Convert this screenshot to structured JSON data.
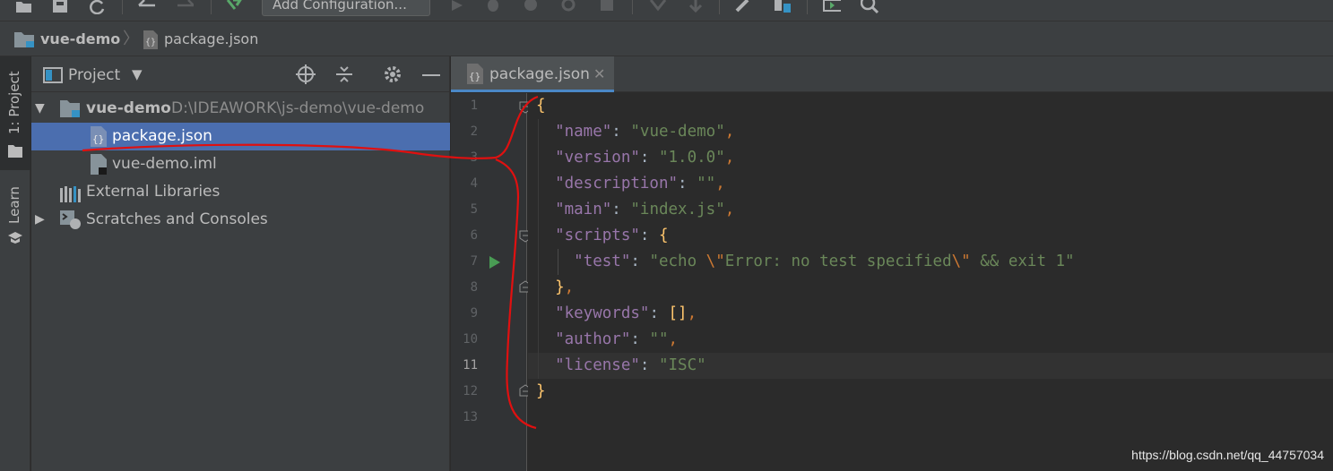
{
  "toolbar": {
    "add_configuration": "Add Configuration..."
  },
  "breadcrumb": {
    "project": "vue-demo",
    "file": "package.json"
  },
  "stripe": {
    "project_label": "1: Project",
    "learn_label": "Learn"
  },
  "project_panel": {
    "title": "Project",
    "tree": [
      {
        "label": "vue-demo",
        "path": "D:\\IDEAWORK\\js-demo\\vue-demo",
        "icon": "folder-icon",
        "expanded": true
      },
      {
        "label": "package.json",
        "icon": "json-file-icon",
        "selected": true
      },
      {
        "label": "vue-demo.iml",
        "icon": "iml-file-icon"
      },
      {
        "label": "External Libraries",
        "icon": "libraries-icon"
      },
      {
        "label": "Scratches and Consoles",
        "icon": "scratches-icon",
        "expanded": false
      }
    ]
  },
  "editor": {
    "tab_label": "package.json",
    "current_line": 11,
    "line_numbers": [
      "1",
      "2",
      "3",
      "4",
      "5",
      "6",
      "7",
      "8",
      "9",
      "10",
      "11",
      "12",
      "13"
    ],
    "lines": [
      [
        {
          "t": "{",
          "c": "br"
        }
      ],
      [
        {
          "t": "  "
        },
        {
          "t": "\"name\"",
          "c": "k"
        },
        {
          "t": ": "
        },
        {
          "t": "\"vue-demo\"",
          "c": "s"
        },
        {
          "t": ",",
          "c": "b"
        }
      ],
      [
        {
          "t": "  "
        },
        {
          "t": "\"version\"",
          "c": "k"
        },
        {
          "t": ": "
        },
        {
          "t": "\"1.0.0\"",
          "c": "s"
        },
        {
          "t": ",",
          "c": "b"
        }
      ],
      [
        {
          "t": "  "
        },
        {
          "t": "\"description\"",
          "c": "k"
        },
        {
          "t": ": "
        },
        {
          "t": "\"\"",
          "c": "s"
        },
        {
          "t": ",",
          "c": "b"
        }
      ],
      [
        {
          "t": "  "
        },
        {
          "t": "\"main\"",
          "c": "k"
        },
        {
          "t": ": "
        },
        {
          "t": "\"index.js\"",
          "c": "s"
        },
        {
          "t": ",",
          "c": "b"
        }
      ],
      [
        {
          "t": "  "
        },
        {
          "t": "\"scripts\"",
          "c": "k"
        },
        {
          "t": ": "
        },
        {
          "t": "{",
          "c": "br"
        }
      ],
      [
        {
          "t": "    "
        },
        {
          "t": "\"test\"",
          "c": "k"
        },
        {
          "t": ": "
        },
        {
          "t": "\"echo ",
          "c": "s"
        },
        {
          "t": "\\\"",
          "c": "esc"
        },
        {
          "t": "Error: no test specified",
          "c": "s"
        },
        {
          "t": "\\\"",
          "c": "esc"
        },
        {
          "t": " && exit 1\"",
          "c": "s"
        }
      ],
      [
        {
          "t": "  "
        },
        {
          "t": "}",
          "c": "br"
        },
        {
          "t": ",",
          "c": "b"
        }
      ],
      [
        {
          "t": "  "
        },
        {
          "t": "\"keywords\"",
          "c": "k"
        },
        {
          "t": ": "
        },
        {
          "t": "[]",
          "c": "br"
        },
        {
          "t": ",",
          "c": "b"
        }
      ],
      [
        {
          "t": "  "
        },
        {
          "t": "\"author\"",
          "c": "k"
        },
        {
          "t": ": "
        },
        {
          "t": "\"\"",
          "c": "s"
        },
        {
          "t": ",",
          "c": "b"
        }
      ],
      [
        {
          "t": "  "
        },
        {
          "t": "\"license\"",
          "c": "k"
        },
        {
          "t": ": "
        },
        {
          "t": "\"ISC\"",
          "c": "s"
        }
      ],
      [
        {
          "t": "}",
          "c": "br"
        }
      ],
      []
    ]
  },
  "watermark": "https://blog.csdn.net/qq_44757034",
  "colors": {
    "background": "#2b2b2b",
    "panel": "#3c3f41",
    "selection": "#4b6eaf",
    "key": "#9876aa",
    "string": "#6a8759",
    "punct": "#cc7832",
    "brace": "#ffc66d",
    "annotation": "#e01010"
  }
}
